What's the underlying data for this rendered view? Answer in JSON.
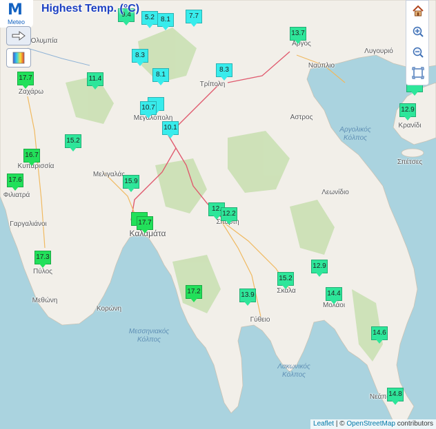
{
  "title": "Highest Temp. (°C)",
  "logo": {
    "text": "Meteo"
  },
  "controls": {
    "left": [
      {
        "icon": "arrow-right-icon"
      },
      {
        "icon": "color-palette-icon"
      }
    ],
    "right": [
      {
        "icon": "home-icon"
      },
      {
        "icon": "zoom-in-icon"
      },
      {
        "icon": "zoom-out-icon"
      },
      {
        "icon": "fit-bounds-icon"
      }
    ]
  },
  "attribution": {
    "leaflet": "Leaflet",
    "sep": " | © ",
    "osm": "OpenStreetMap",
    "suffix": " contributors"
  },
  "colors": {
    "green": "#22e05a",
    "teal": "#2ee69a",
    "cyan": "#38ecec",
    "land": "#f2efe9",
    "sea": "#aad3df"
  },
  "places": [
    {
      "name": "Αργος"
    },
    {
      "name": "Ναύπλιο"
    },
    {
      "name": "Λυγουριό"
    },
    {
      "name": "Τρίπολη"
    },
    {
      "name": "Μεγαλόπολη"
    },
    {
      "name": "Ζαχάρω"
    },
    {
      "name": "Κυπαρισσία"
    },
    {
      "name": "Φιλιατρά"
    },
    {
      "name": "Γαργαλιάνοι"
    },
    {
      "name": "Μελιγαλάς"
    },
    {
      "name": "Καλαμάτα"
    },
    {
      "name": "Πύλος"
    },
    {
      "name": "Μεθώνη"
    },
    {
      "name": "Κορώνη"
    },
    {
      "name": "Αστρος"
    },
    {
      "name": "Λεωνίδιο"
    },
    {
      "name": "Σπάρτη"
    },
    {
      "name": "Σκάλα"
    },
    {
      "name": "Γύθειο"
    },
    {
      "name": "Μολάοι"
    },
    {
      "name": "Νεάπολη"
    },
    {
      "name": "Κρανίδι"
    },
    {
      "name": "Σπέτσες"
    },
    {
      "name": "Ολυμπία"
    }
  ],
  "seas": [
    {
      "name": "Αργολικός Κόλπος"
    },
    {
      "name": "Μεσσηνιακός Κόλπος"
    },
    {
      "name": "Λακωνικός Κόλπος"
    }
  ],
  "stations": [
    {
      "value": "9.4",
      "level": "teal"
    },
    {
      "value": "5.2",
      "level": "cyan"
    },
    {
      "value": "8.1",
      "level": "cyan"
    },
    {
      "value": "7.7",
      "level": "cyan"
    },
    {
      "value": "13.7",
      "level": "teal"
    },
    {
      "value": "8.3",
      "level": "cyan"
    },
    {
      "value": "17.7",
      "level": "green"
    },
    {
      "value": "11.4",
      "level": "teal"
    },
    {
      "value": "8.1",
      "level": "cyan"
    },
    {
      "value": "8.3",
      "level": "cyan"
    },
    {
      "value": "",
      "level": "teal"
    },
    {
      "value": "12.9",
      "level": "teal"
    },
    {
      "value": "",
      "level": "cyan"
    },
    {
      "value": "10.7",
      "level": "cyan"
    },
    {
      "value": "10.1",
      "level": "cyan"
    },
    {
      "value": "15.2",
      "level": "teal"
    },
    {
      "value": "16.7",
      "level": "green"
    },
    {
      "value": "17.6",
      "level": "green"
    },
    {
      "value": "15.9",
      "level": "teal"
    },
    {
      "value": "12.",
      "level": "teal"
    },
    {
      "value": "12.2",
      "level": "teal"
    },
    {
      "value": "",
      "level": "green"
    },
    {
      "value": "17.7",
      "level": "green"
    },
    {
      "value": "17.3",
      "level": "green"
    },
    {
      "value": "12.9",
      "level": "teal"
    },
    {
      "value": "15.2",
      "level": "teal"
    },
    {
      "value": "17.2",
      "level": "green"
    },
    {
      "value": "13.9",
      "level": "teal"
    },
    {
      "value": "14.4",
      "level": "teal"
    },
    {
      "value": "14.6",
      "level": "teal"
    },
    {
      "value": "14.8",
      "level": "teal"
    }
  ]
}
